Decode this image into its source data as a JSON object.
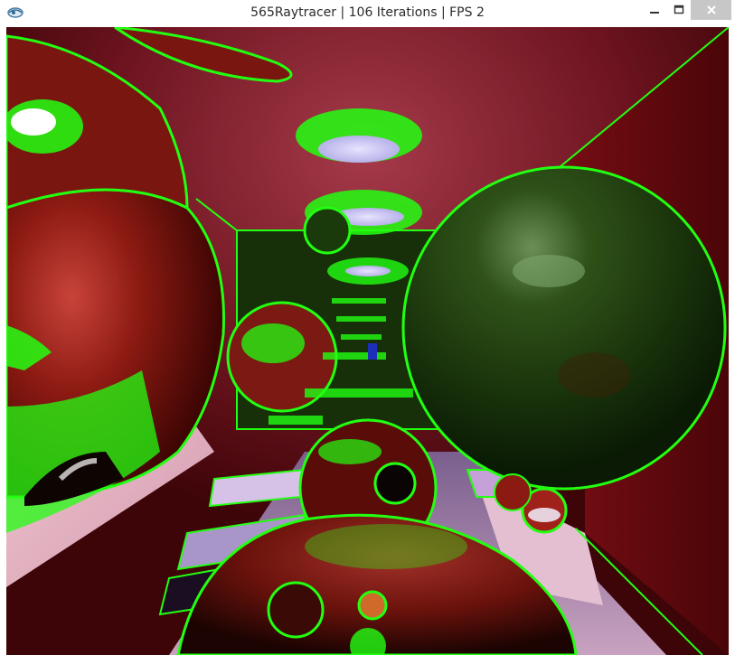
{
  "window": {
    "title": "565Raytracer | 106 Iterations | FPS 2",
    "app_icon": "gl-app-icon",
    "controls": {
      "minimize_icon": "minimize-icon",
      "maximize_icon": "maximize-icon",
      "close_icon": "close-icon"
    }
  },
  "scene": {
    "description_icon": "raytraced-render",
    "colors": {
      "outline": "#22ff11",
      "wall": "#8a1520",
      "floor_light": "#e8b9c7",
      "floor_purple": "#9c86b3",
      "sphere_red": "#8a1a12",
      "sphere_green": "#2b4a14",
      "light": "#c9c4f2"
    }
  }
}
